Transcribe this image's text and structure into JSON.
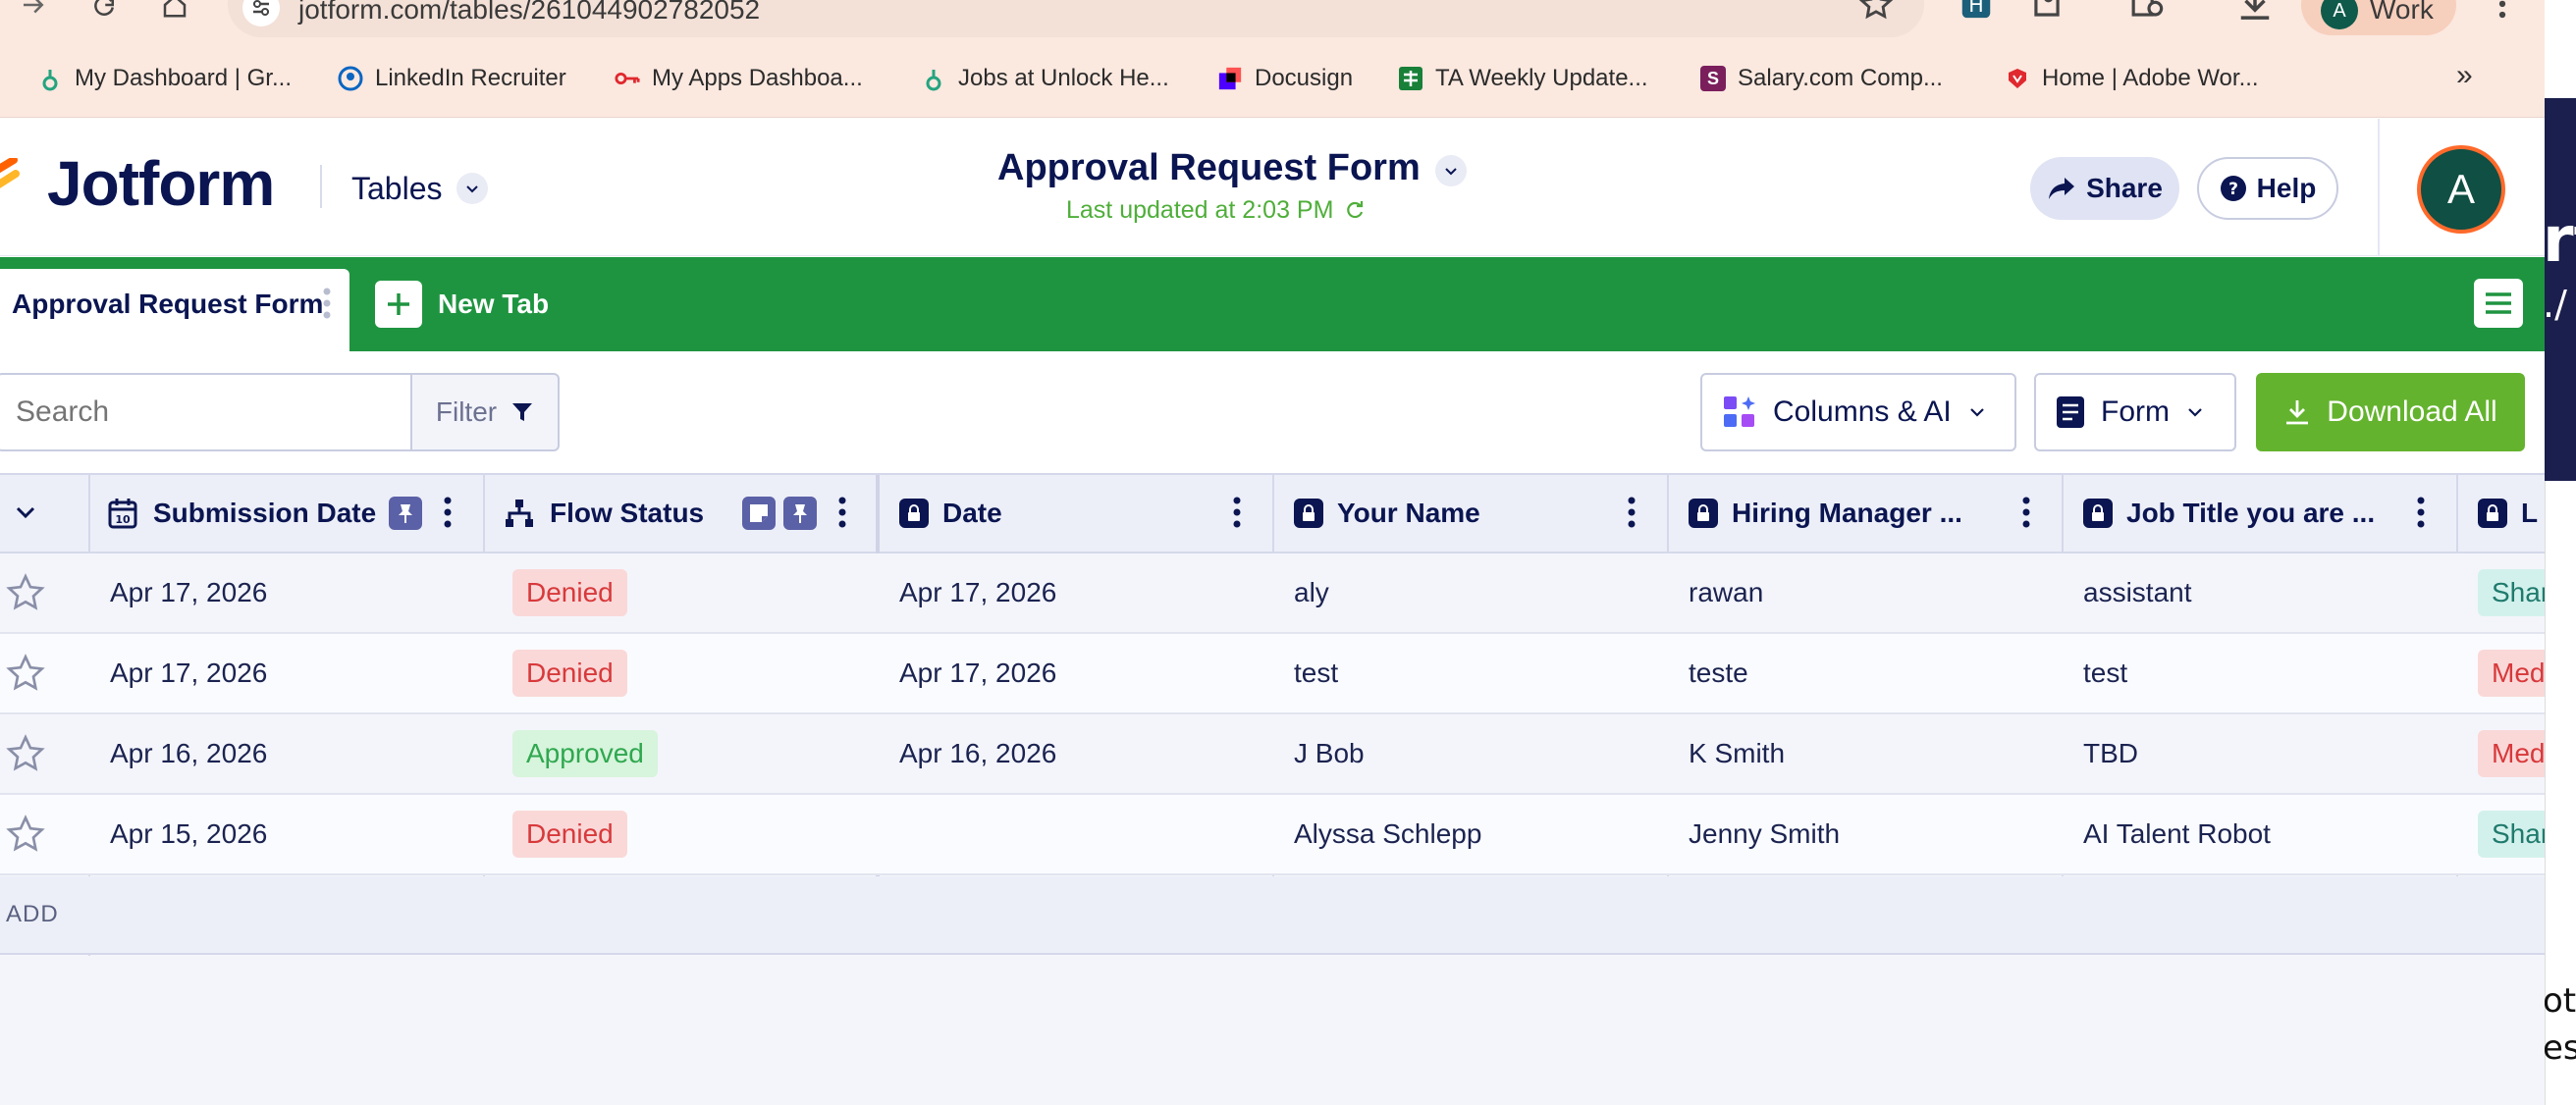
{
  "browser": {
    "url": "jotform.com/tables/261044902782052",
    "profile_initial": "A",
    "profile_label": "Work",
    "bookmarks": [
      {
        "label": "My Dashboard | Gr...",
        "icon": "greenhouse-icon",
        "color": "#24a47f"
      },
      {
        "label": "LinkedIn Recruiter",
        "icon": "linkedin-recruiter-icon",
        "color": "#0a66c2"
      },
      {
        "label": "My Apps Dashboa...",
        "icon": "key-icon",
        "color": "#e0282e"
      },
      {
        "label": "Jobs at Unlock He...",
        "icon": "greenhouse-icon",
        "color": "#24a47f"
      },
      {
        "label": "Docusign",
        "icon": "docusign-icon",
        "color": "#4c00ff"
      },
      {
        "label": "TA Weekly Update...",
        "icon": "sheets-icon",
        "color": "#188038"
      },
      {
        "label": "Salary.com Comp...",
        "icon": "salary-icon",
        "color": "#7a1f5c"
      },
      {
        "label": "Home | Adobe Wor...",
        "icon": "adobe-icon",
        "color": "#e0282e"
      }
    ],
    "more_glyph": "»"
  },
  "header": {
    "logo_text": "Jotform",
    "tables_label": "Tables",
    "form_title": "Approval Request Form",
    "updated_text": "Last updated at 2:03 PM",
    "share_label": "Share",
    "help_label": "Help",
    "avatar_initial": "A"
  },
  "tabs": {
    "active_label": "Approval Request Form",
    "new_tab_label": "New Tab"
  },
  "toolbar": {
    "search_placeholder": "Search",
    "filter_label": "Filter",
    "columns_label": "Columns & AI",
    "form_label": "Form",
    "download_label": "Download All"
  },
  "table": {
    "columns": [
      {
        "label": "Submission Date",
        "icon": "calendar-icon"
      },
      {
        "label": "Flow Status",
        "icon": "flow-icon"
      },
      {
        "label": "Date",
        "icon": "lock-icon"
      },
      {
        "label": "Your Name",
        "icon": "lock-icon"
      },
      {
        "label": "Hiring Manager ...",
        "icon": "lock-icon"
      },
      {
        "label": "Job Title you are ...",
        "icon": "lock-icon"
      },
      {
        "label": "L",
        "icon": "lock-icon"
      }
    ],
    "rows": [
      {
        "submission_date": "Apr 17, 2026",
        "status": "Denied",
        "date": "Apr 17, 2026",
        "name": "aly",
        "manager": "rawan",
        "job_title": "assistant",
        "chip": "Shar",
        "chip_color": "#d3f1ec"
      },
      {
        "submission_date": "Apr 17, 2026",
        "status": "Denied",
        "date": "Apr 17, 2026",
        "name": "test",
        "manager": "teste",
        "job_title": "test",
        "chip": "Med",
        "chip_color": "#fad8d8"
      },
      {
        "submission_date": "Apr 16, 2026",
        "status": "Approved",
        "date": "Apr 16, 2026",
        "name": "J Bob",
        "manager": "K Smith",
        "job_title": "TBD",
        "chip": "Med",
        "chip_color": "#fad8d8"
      },
      {
        "submission_date": "Apr 15, 2026",
        "status": "Denied",
        "date": "",
        "name": "Alyssa Schlepp",
        "manager": "Jenny Smith",
        "job_title": "AI Talent Robot",
        "chip": "Shar",
        "chip_color": "#d3f1ec"
      }
    ],
    "add_label": "ADD"
  },
  "side_strip": {
    "line1": "rt",
    "line2": "./",
    "line3": "otfo",
    "line4": "es r"
  },
  "colors": {
    "brand_navy": "#0a1551",
    "tab_green": "#1f9440",
    "download_green": "#64b32e",
    "denied_red": "#d8393b",
    "approved_green": "#2fa84f"
  }
}
